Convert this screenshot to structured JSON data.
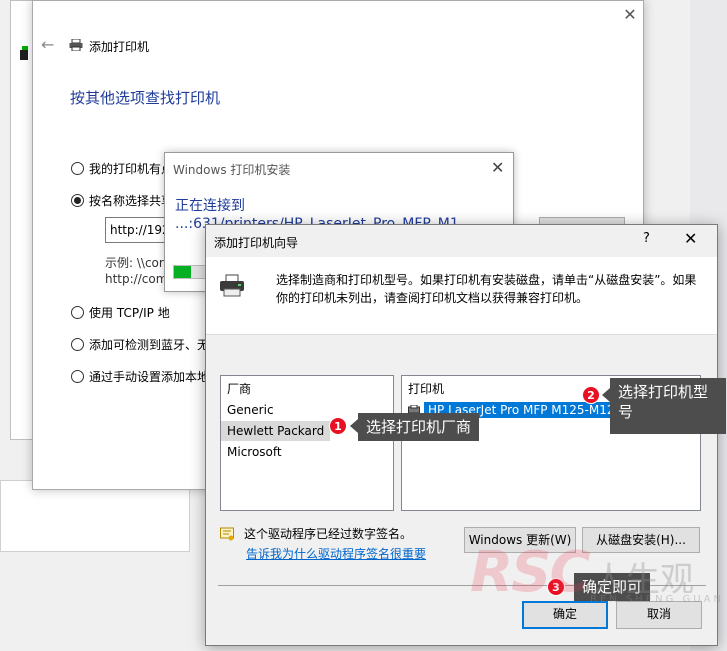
{
  "main_wizard": {
    "title": "添加打印机",
    "heading": "按其他选项查找打印机",
    "options": [
      {
        "label": "我的打印机有点",
        "checked": false
      },
      {
        "label": "按名称选择共享",
        "checked": true
      },
      {
        "label": "使用 TCP/IP 地",
        "checked": false
      },
      {
        "label": "添加可检测到蓝牙、无",
        "checked": false
      },
      {
        "label": "通过手动设置添加本地",
        "checked": false
      }
    ],
    "url_value": "http://192",
    "example_line1": "示例: \\\\cor",
    "example_line2": "http://com"
  },
  "install_dialog": {
    "title": "Windows 打印机安装",
    "connecting": "正在连接到",
    "url": "...:631/printers/HP_LaserJet_Pro_MFP_M1",
    "progress": 0.35
  },
  "driver_wizard": {
    "title": "添加打印机向导",
    "help": "?",
    "description": "选择制造商和打印机型号。如果打印机有安装磁盘，请单击“从磁盘安装”。如果你的打印机未列出，请查阅打印机文档以获得兼容打印机。",
    "manufacturer_header": "厂商",
    "manufacturers": [
      "Generic",
      "Hewlett Packard",
      "Microsoft"
    ],
    "selected_manufacturer": "Hewlett Packard",
    "printer_header": "打印机",
    "printers": [
      "HP LaserJet Pro MFP M125-M126 PCLmS"
    ],
    "signed_text": "这个驱动程序已经过数字签名。",
    "signed_link": "告诉我为什么驱动程序签名很重要",
    "windows_update_button": "Windows 更新(W)",
    "have_disk_button": "从磁盘安装(H)...",
    "ok_button": "确定",
    "cancel_button": "取消"
  },
  "annotations": [
    {
      "number": "1",
      "text": "选择打印机厂商"
    },
    {
      "number": "2",
      "text_line1": "选择打印机型",
      "text_line2": "号"
    },
    {
      "number": "3",
      "text": "确定即可"
    }
  ],
  "watermark": {
    "logo": "RSC",
    "text_cn": "人生观",
    "text_en": "REN SHENG GUAN"
  },
  "colors": {
    "accent": "#0078d7",
    "heading_blue": "#1f3c9b",
    "badge_red": "#e81123",
    "callout_bg": "#4d4d4d"
  }
}
